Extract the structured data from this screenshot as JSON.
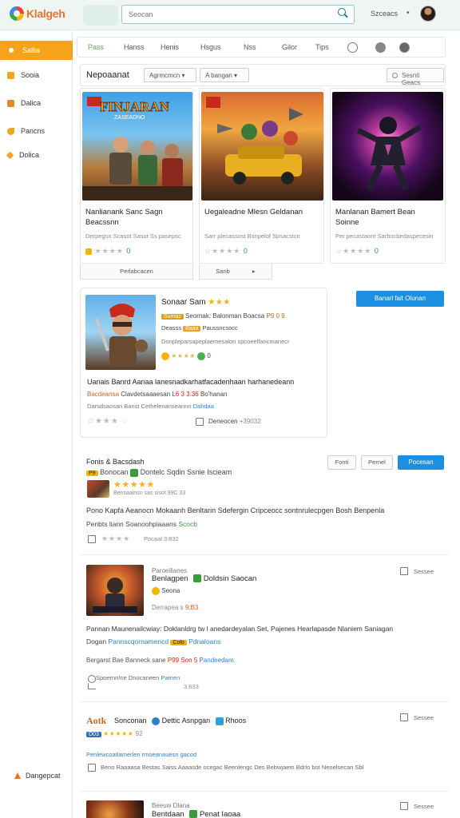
{
  "app": {
    "logo_text": "Klalgeh"
  },
  "search": {
    "placeholder": "Seocan",
    "value": ""
  },
  "user": {
    "name": "Szceacs",
    "caret": "▾"
  },
  "sidebar": {
    "items": [
      {
        "label": "Sallia",
        "active": true
      },
      {
        "label": "Sooia",
        "active": false
      },
      {
        "label": "Dalica",
        "active": false
      },
      {
        "label": "Pancns",
        "active": false
      },
      {
        "label": "Dolica",
        "active": false
      }
    ],
    "footer": "Dangepcat"
  },
  "tabs": {
    "items": [
      "Pass",
      "Hanss",
      "Henis",
      "Hsgus",
      "Nss",
      "Gilor",
      "Tips"
    ],
    "active_index": 0,
    "more": "•••"
  },
  "filter": {
    "title": "Nepoaanat",
    "dropdown1": "Agrmcmcn ▾",
    "dropdown2": "A bangan ▾",
    "search_placeholder": "Sesnti Geacs"
  },
  "cards": [
    {
      "img_title": "FINJARAN",
      "img_sub": "ZASEADNO",
      "title": "Nanlianank Sanc Sagn Beacssnn",
      "subtitle": "Derpegsn Scasot Sasut Ss pasepsc",
      "rating_count": "0",
      "button": "Perlabcacen"
    },
    {
      "title": "Uegaleadne Mlesn Geldanan",
      "subtitle": "Sarr plecassost Bsnpelof Spsacstcn",
      "rating_count": "0",
      "button": "Sanb"
    },
    {
      "title": "Manlanan Bamert Bean Soinne",
      "subtitle": "Per pecastaont Sarbocbedaspecesin",
      "rating_count": "0",
      "button": ""
    }
  ],
  "featured_button": "Banarl fait Olunan",
  "featured": {
    "title": "Sonaar Sam",
    "badge": "Sumaz",
    "line2": "Seornak: Balonman Boacsa",
    "badge2": "P9 0 9",
    "line3_label": "Deasss",
    "line3_badge": "Baaa",
    "line3_rest": "Paussncsocc",
    "line4": "Donpleparsapeplaemesalon spcoeelfancmanecr",
    "rating_count": "0",
    "desc_line1": "Uanais Banrd Aanaa lanesnadkarhatfacadenhaan harhanedeann",
    "desc_line2_a": "Bacdeansa",
    "desc_line2_b": "Clavdetsaaaesan",
    "desc_line2_c": "L6 3 3:36",
    "desc_line2_d": "Bo'hanan",
    "desc_line3_a": "Darsdsaosan Banst Cethelenanseannn",
    "desc_line3_b": "Dahdaa",
    "checkbox_label": "Deneocen",
    "checkbox_num": "+39032"
  },
  "list_buttons": {
    "b1": "Fonti",
    "b2": "Pernel",
    "b3": "Pocesan"
  },
  "list": [
    {
      "title": "Fonis & Bacsdash",
      "tag1": "Bonocan",
      "tag2": "Dontelc Sqdin Ssnie Iscieam",
      "stars": "★★★★★",
      "sub": "Bensaainsn sas sisot 99C 33",
      "desc1": "Pono Kapfa Aeanocn Mokaanh  Benltarin Sdefergin Cripceocc sontnrulecpgen Bosh Benpenla",
      "desc2_a": "Penbts liann Soanoohpiaaans",
      "desc2_b": "Scocb",
      "foot": "Pocaal",
      "foot_num": "3:832"
    },
    {
      "title": "Paroeillanes",
      "tag": "Benlagpen",
      "tag2": "Doldsin Saocan",
      "sub": "Seona",
      "sub2_a": "Derrapea s",
      "sub2_b": "9:B3",
      "desc1": "Pannan Maunenailcwiay: Doklanldrg tw l anedardeyalan Set, Pajenes Hearlapasde Nlaniem Saniagan",
      "desc2_a": "Dogan",
      "desc2_b": "Pannscqornamencd",
      "desc2_c": "Colo",
      "desc2_d": "Pdnaloans",
      "desc3_a": "Bergarst Bae Banneck sane",
      "desc3_b": "P99 Son 5",
      "desc3_c": "Pandeedam.",
      "chk_a": "Spoernn!ne",
      "chk_b": "Dnocaneen",
      "chk_c": "Pamen",
      "num": "3.633",
      "corner": "Sessee"
    },
    {
      "title": "Aotk",
      "tag1": "Sonconan",
      "tag2": "Dettic Asnpgan",
      "tag3": "Rhoos",
      "badge": "D03",
      "stars": "★★★★★",
      "count": "92",
      "sub": "Penlewcoatlamerlen rmoeanauesn gacod",
      "desc": "Beno Raaaasa Bestas Saiss  Aaaasde ocegac Beenlengc Des Bebwjaem Bdrlo bot Nenelsecan Sbl",
      "corner": "Sessee"
    },
    {
      "title": "Beeuw Dlana",
      "tag": "Bentdaan",
      "tag2": "Penat Iaoaa",
      "corner": "Sessee"
    }
  ],
  "colors": {
    "accent": "#f7a21b",
    "primary": "#1c8fe0",
    "green": "#3a9a3a",
    "red": "#c82a1e"
  }
}
